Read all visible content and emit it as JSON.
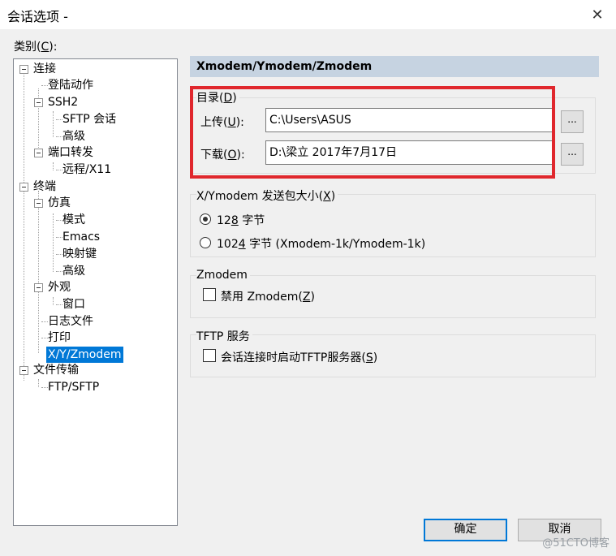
{
  "window": {
    "title": "会话选项 -",
    "close_glyph": "✕"
  },
  "category_label": {
    "text": "类别(",
    "key": "C",
    "suffix": "):"
  },
  "tree": {
    "connection": "连接",
    "login_actions": "登陆动作",
    "ssh2": "SSH2",
    "sftp_session": "SFTP 会话",
    "ssh2_advanced": "高级",
    "port_forwarding": "端口转发",
    "remote_x11": "远程/X11",
    "terminal": "终端",
    "emulation": "仿真",
    "modes": "模式",
    "emacs": "Emacs",
    "mapped_keys": "映射键",
    "emulation_advanced": "高级",
    "appearance": "外观",
    "window": "窗口",
    "log_file": "日志文件",
    "printing": "打印",
    "xyzmodem": "X/Y/Zmodem",
    "file_transfer": "文件传输",
    "ftp_sftp": "FTP/SFTP"
  },
  "panel": {
    "header": "Xmodem/Ymodem/Zmodem",
    "directory": {
      "title": "目录(",
      "title_key": "D",
      "title_suffix": ")",
      "upload_label": "上传(",
      "upload_key": "U",
      "upload_suffix": "):",
      "upload_value": "C:\\Users\\ASUS",
      "download_label": "下载(",
      "download_key": "O",
      "download_suffix": "):",
      "download_value": "D:\\梁立 2017年7月17日",
      "browse_label": "..."
    },
    "packet": {
      "title": "X/Ymodem 发送包大小(",
      "title_key": "X",
      "title_suffix": ")",
      "opt128_prefix": "12",
      "opt128_key": "8",
      "opt128_suffix": " 字节",
      "opt1024_prefix": "102",
      "opt1024_key": "4",
      "opt1024_suffix": " 字节  (Xmodem-1k/Ymodem-1k)",
      "selected": "128"
    },
    "zmodem": {
      "title": "Zmodem",
      "disable_label": "禁用 Zmodem(",
      "disable_key": "Z",
      "disable_suffix": ")",
      "disable_checked": false
    },
    "tftp": {
      "title": "TFTP 服务",
      "start_label": "会话连接时启动TFTP服务器(",
      "start_key": "S",
      "start_suffix": ")",
      "start_checked": false
    }
  },
  "buttons": {
    "ok": "确定",
    "cancel": "取消"
  },
  "watermark": "@51CTO博客",
  "colors": {
    "header_bg": "#c6d3e1",
    "highlight_border": "#e0272d",
    "selection": "#0078d7"
  }
}
